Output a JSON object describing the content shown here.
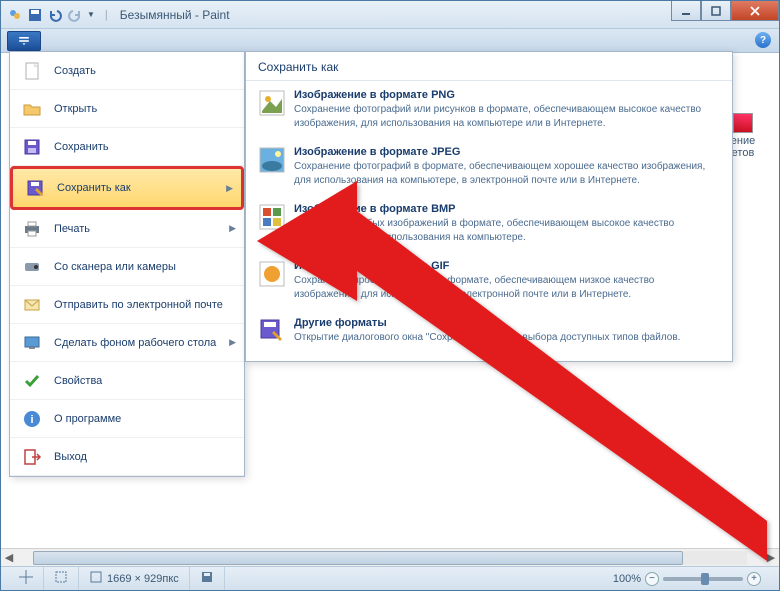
{
  "window": {
    "title": "Безымянный - Paint"
  },
  "menu": {
    "create": "Создать",
    "open": "Открыть",
    "save": "Сохранить",
    "save_as": "Сохранить как",
    "print": "Печать",
    "scanner": "Со сканера или камеры",
    "email": "Отправить по электронной почте",
    "desktop_bg": "Сделать фоном рабочего стола",
    "properties": "Свойства",
    "about": "О программе",
    "exit": "Выход"
  },
  "submenu": {
    "title": "Сохранить как",
    "png": {
      "title": "Изображение в формате PNG",
      "desc": "Сохранение фотографий или рисунков в формате, обеспечивающем высокое качество изображения, для использования на компьютере или в Интернете."
    },
    "jpeg": {
      "title": "Изображение в формате JPEG",
      "desc": "Сохранение фотографий в формате, обеспечивающем хорошее качество изображения, для использования на компьютере, в электронной почте или в Интернете."
    },
    "bmp": {
      "title": "Изображение в формате BMP",
      "desc": "Сохранение любых изображений в формате, обеспечивающем высокое качество изображения, для использования на компьютере."
    },
    "gif": {
      "title": "Изображение в формате GIF",
      "desc": "Сохранение простых рисунков в формате, обеспечивающем низкое качество изображения, для использования в электронной почте или в Интернете."
    },
    "other": {
      "title": "Другие форматы",
      "desc": "Открытие диалогового окна \"Сохранить как\" для выбора доступных типов файлов."
    }
  },
  "right_pane": {
    "label1": "ение",
    "label2": "етов"
  },
  "status": {
    "dimensions": "1669 × 929пкс",
    "zoom": "100%"
  }
}
